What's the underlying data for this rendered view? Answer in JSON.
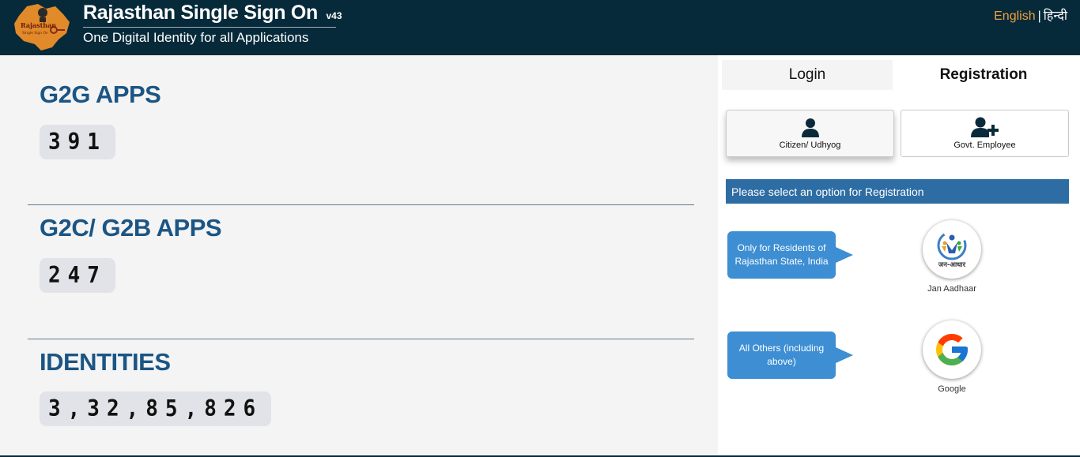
{
  "header": {
    "logo_text_line1": "Rajasthan",
    "logo_text_line2": "Single Sign On",
    "title": "Rajasthan Single Sign On",
    "version": "v43",
    "subtitle": "One Digital Identity for all Applications",
    "lang_english": "English",
    "lang_separator": "|",
    "lang_hindi": "हिन्दी"
  },
  "stats": [
    {
      "label": "G2G APPS",
      "value": "391"
    },
    {
      "label": "G2C/ G2B APPS",
      "value": "247"
    },
    {
      "label": "IDENTITIES",
      "value": "3,32,85,826"
    }
  ],
  "tabs": {
    "login": "Login",
    "registration": "Registration",
    "active": "registration"
  },
  "user_types": {
    "citizen": "Citizen/ Udhyog",
    "govt": "Govt. Employee"
  },
  "info_bar": "Please select an option for Registration",
  "options": [
    {
      "bubble": "Only for Residents of Rajasthan State, India",
      "label": "Jan Aadhaar",
      "logo_text": "जन-आधार",
      "icon": "jan-aadhaar-logo"
    },
    {
      "bubble": "All Others (including above)",
      "label": "Google",
      "icon": "google-logo"
    }
  ],
  "colors": {
    "header_bg": "#062a3a",
    "stat_label": "#1b5584",
    "accent_orange": "#f0a03a",
    "info_bar_bg": "#2e6da4",
    "bubble_bg": "#3d8ed3"
  }
}
